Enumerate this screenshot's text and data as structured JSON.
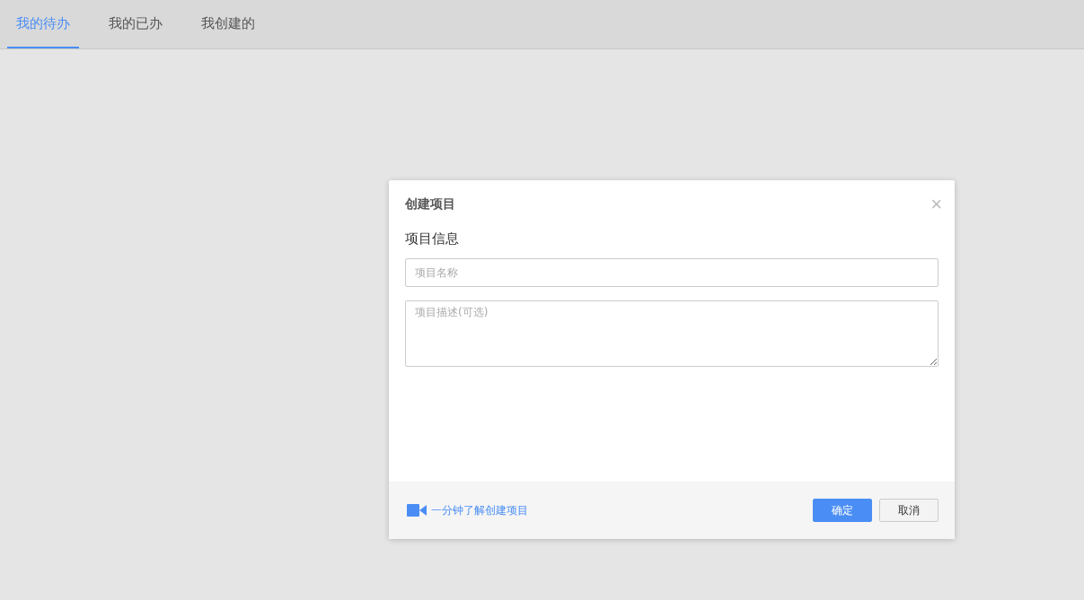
{
  "tabs": [
    {
      "label": "我的待办",
      "selected": true
    },
    {
      "label": "我的已办",
      "selected": false
    },
    {
      "label": "我创建的",
      "selected": false
    }
  ],
  "dialog": {
    "title": "创建项目",
    "close": "×",
    "section_title": "项目信息",
    "name_field": {
      "placeholder": "项目名称"
    },
    "description_field": {
      "placeholder": "项目描述(可选)"
    },
    "help_link": "一分钟了解创建项目",
    "buttons": [
      {
        "label": "确定",
        "kind": "primary"
      },
      {
        "label": "取消",
        "kind": "default"
      }
    ]
  }
}
